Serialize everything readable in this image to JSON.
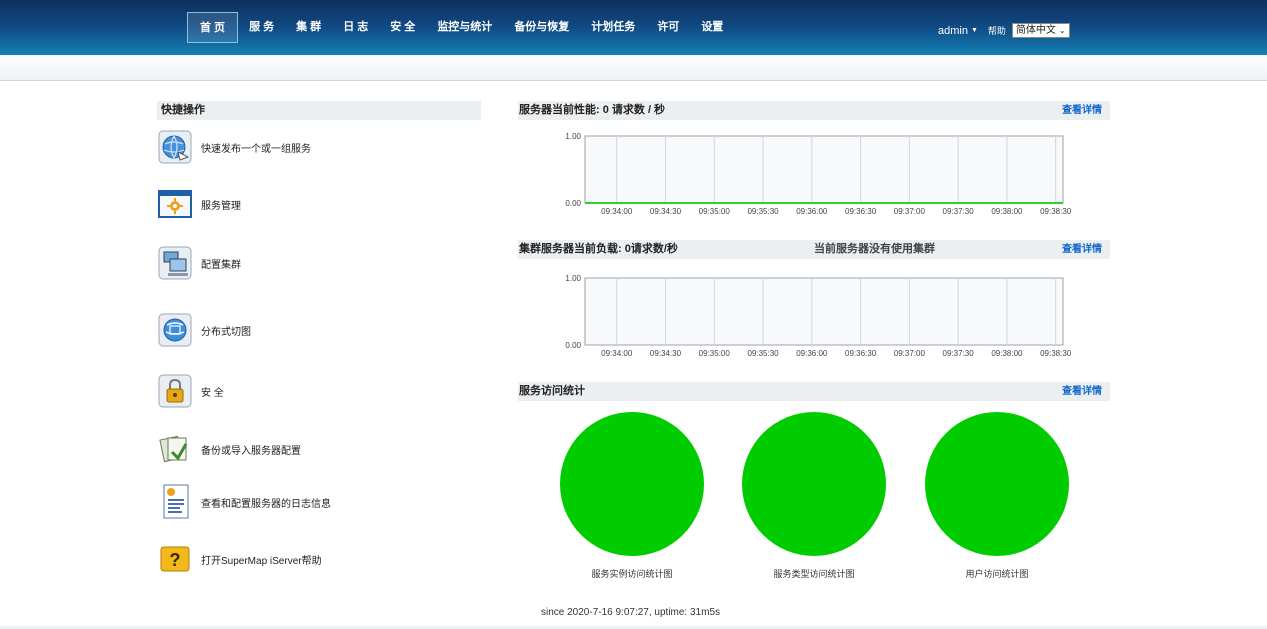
{
  "nav": {
    "items": [
      "首 页",
      "服 务",
      "集 群",
      "日 志",
      "安 全",
      "监控与统计",
      "备份与恢复",
      "计划任务",
      "许可",
      "设置"
    ],
    "active_index": 0
  },
  "user": {
    "name": "admin",
    "help": "帮助",
    "language": "简体中文"
  },
  "quick_ops": {
    "title": "快捷操作",
    "items": [
      {
        "label": "快速发布一个或一组服务",
        "icon": "globe-publish-icon"
      },
      {
        "label": "服务管理",
        "icon": "gear-window-icon"
      },
      {
        "label": "配置集群",
        "icon": "cluster-computers-icon"
      },
      {
        "label": "分布式切图",
        "icon": "globe-tiles-icon"
      },
      {
        "label": "安 全",
        "icon": "lock-icon"
      },
      {
        "label": "备份或导入服务器配置",
        "icon": "backup-documents-icon"
      },
      {
        "label": "查看和配置服务器的日志信息",
        "icon": "log-document-icon"
      },
      {
        "label": "打开SuperMap iServer帮助",
        "icon": "help-question-icon"
      }
    ]
  },
  "panels": {
    "performance": {
      "title": "服务器当前性能:  0 请求数 / 秒",
      "link": "查看详情"
    },
    "cluster": {
      "title": "集群服务器当前负载: 0请求数/秒",
      "note": "当前服务器没有使用集群",
      "link": "查看详情"
    },
    "stats": {
      "title": "服务访问统计",
      "link": "查看详情"
    }
  },
  "chart_data": [
    {
      "type": "line",
      "name": "performance",
      "x": [
        "09:34:00",
        "09:34:30",
        "09:35:00",
        "09:35:30",
        "09:36:00",
        "09:36:30",
        "09:37:00",
        "09:37:30",
        "09:38:00",
        "09:38:30"
      ],
      "y_ticks": [
        "1.00",
        "0.00"
      ],
      "ylim": [
        0,
        1
      ],
      "series": [
        {
          "values": [
            0,
            0,
            0,
            0,
            0,
            0,
            0,
            0,
            0,
            0,
            0
          ],
          "color": "#33cc33"
        }
      ],
      "grid": true
    },
    {
      "type": "line",
      "name": "cluster",
      "x": [
        "09:34:00",
        "09:34:30",
        "09:35:00",
        "09:35:30",
        "09:36:00",
        "09:36:30",
        "09:37:00",
        "09:37:30",
        "09:38:00",
        "09:38:30"
      ],
      "y_ticks": [
        "1.00",
        "0.00"
      ],
      "ylim": [
        0,
        1
      ],
      "series": [],
      "grid": true
    },
    {
      "type": "pie",
      "pies": [
        {
          "title": "服务实例访问统计图",
          "slices": [
            {
              "value": 1,
              "color": "#00cc00"
            }
          ]
        },
        {
          "title": "服务类型访问统计图",
          "slices": [
            {
              "value": 1,
              "color": "#00cc00"
            }
          ]
        },
        {
          "title": "用户访问统计图",
          "slices": [
            {
              "value": 1,
              "color": "#00cc00"
            }
          ]
        }
      ]
    }
  ],
  "footer": "since 2020-7-16 9:07:27, uptime: 31m5s",
  "colors": {
    "nav_top": "#0d2f5c",
    "nav_bottom": "#1480b4",
    "link": "#1166cc",
    "series": "#33cc33",
    "pie": "#00cc00"
  }
}
